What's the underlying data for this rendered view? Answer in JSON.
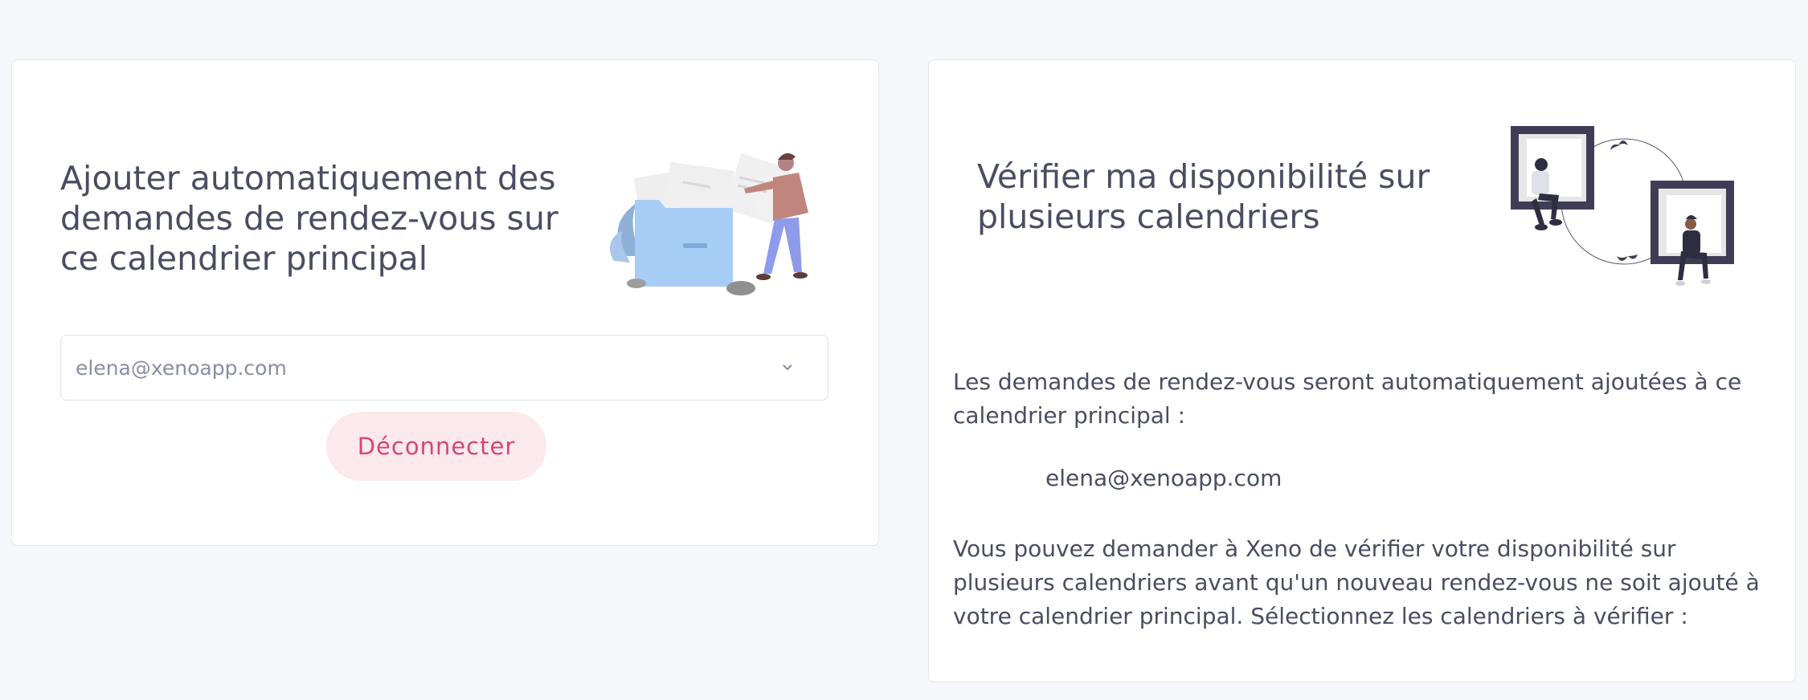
{
  "left_card": {
    "title": "Ajouter automatiquement des demandes de rendez-vous sur ce calendrier principal",
    "select_value": "elena@xenoapp.com",
    "disconnect_label": "Déconnecter"
  },
  "right_card": {
    "title": "Vérifier ma disponibilité sur plusieurs calendriers",
    "paragraph_1": "Les demandes de rendez-vous seront automatiquement ajoutées à ce calendrier principal :",
    "primary_calendar": "elena@xenoapp.com",
    "paragraph_2": "Vous pouvez demander à Xeno de vérifier votre disponibilité sur plusieurs calendriers avant qu'un nouveau rendez-vous ne soit ajouté à votre calendrier principal. Sélectionnez les calendriers à vérifier :"
  },
  "icons": {
    "select_chevron": "chevron-down-icon",
    "left_illustration": "folder-illustration",
    "right_illustration": "windows-people-illustration"
  },
  "colors": {
    "accent": "#d4486f",
    "button_bg": "#fbe9ee",
    "background": "#f6f7fa"
  }
}
